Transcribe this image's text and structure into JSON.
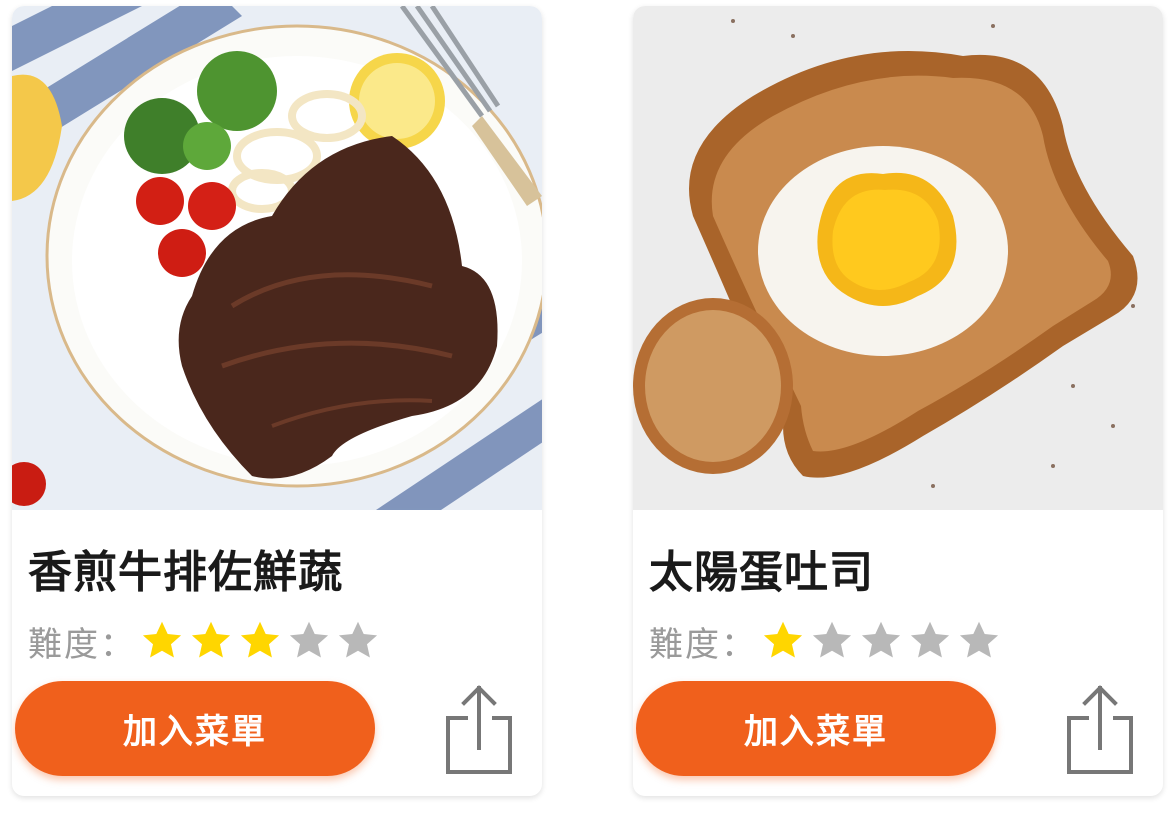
{
  "cards": [
    {
      "title": "香煎牛排佐鮮蔬",
      "difficulty_label": "難度：",
      "rating": 3,
      "rating_max": 5,
      "add_button": "加入菜單",
      "image": "steak-with-vegetables-photo",
      "share_icon": "share-icon"
    },
    {
      "title": "太陽蛋吐司",
      "difficulty_label": "難度：",
      "rating": 1,
      "rating_max": 5,
      "add_button": "加入菜單",
      "image": "egg-in-toast-photo",
      "share_icon": "share-icon"
    }
  ],
  "colors": {
    "accent": "#f0601c",
    "star_filled": "#ffd600",
    "star_empty": "#b8b8b8",
    "label_gray": "#9a9a9a",
    "title": "#1a1a1a"
  }
}
